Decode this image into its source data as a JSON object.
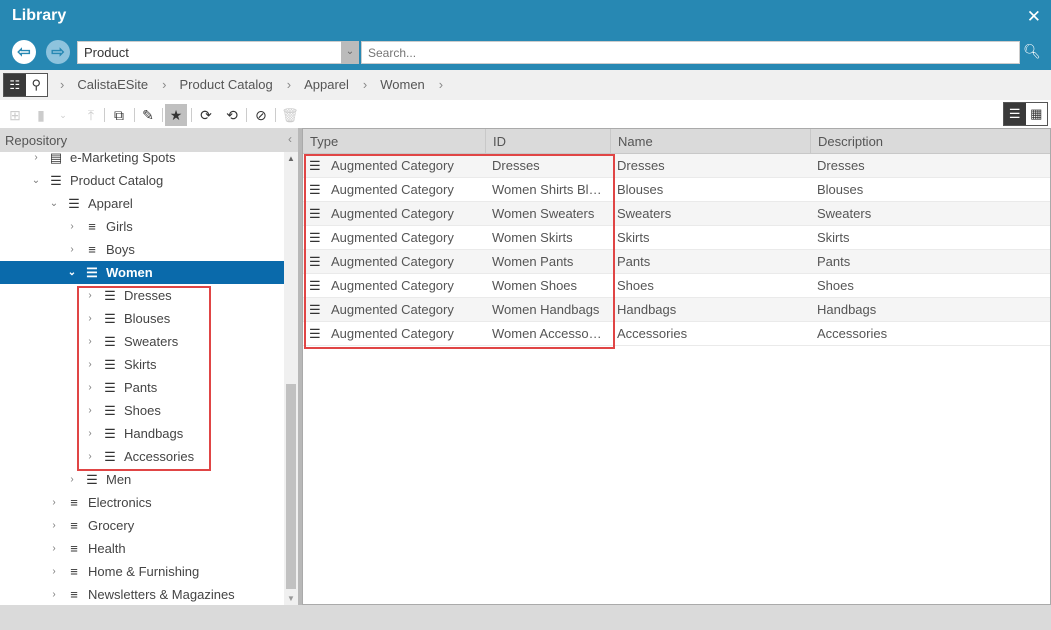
{
  "window": {
    "title": "Library",
    "close_icon": "close-icon"
  },
  "nav": {
    "back_icon": "arrow-left-icon",
    "forward_icon": "arrow-right-icon",
    "type_value": "Product",
    "search_placeholder": "Search...",
    "search_icon": "search-icon"
  },
  "breadcrumb": {
    "items": [
      "CalistaESite",
      "Product Catalog",
      "Apparel",
      "Women"
    ]
  },
  "toolbar": {
    "buttons": [
      "create-folder",
      "create-content",
      "dropdown",
      "move-up",
      "copy",
      "edit",
      "bookmark",
      "sync",
      "sync-check",
      "unsync",
      "delete"
    ]
  },
  "repository": {
    "header": "Repository",
    "nodes": [
      {
        "label": "e-Marketing Spots",
        "depth": 2,
        "expanded": false,
        "icon": "table-icon"
      },
      {
        "label": "Product Catalog",
        "depth": 2,
        "expanded": true,
        "icon": "augmented-category-icon"
      },
      {
        "label": "Apparel",
        "depth": 3,
        "expanded": true,
        "icon": "augmented-category-icon"
      },
      {
        "label": "Girls",
        "depth": 4,
        "expanded": false,
        "icon": "category-icon"
      },
      {
        "label": "Boys",
        "depth": 4,
        "expanded": false,
        "icon": "category-icon"
      },
      {
        "label": "Women",
        "depth": 4,
        "expanded": true,
        "selected": true,
        "icon": "augmented-category-icon"
      },
      {
        "label": "Dresses",
        "depth": 5,
        "expanded": false,
        "icon": "augmented-category-icon"
      },
      {
        "label": "Blouses",
        "depth": 5,
        "expanded": false,
        "icon": "augmented-category-icon"
      },
      {
        "label": "Sweaters",
        "depth": 5,
        "expanded": false,
        "icon": "augmented-category-icon"
      },
      {
        "label": "Skirts",
        "depth": 5,
        "expanded": false,
        "icon": "augmented-category-icon"
      },
      {
        "label": "Pants",
        "depth": 5,
        "expanded": false,
        "icon": "augmented-category-icon"
      },
      {
        "label": "Shoes",
        "depth": 5,
        "expanded": false,
        "icon": "augmented-category-icon"
      },
      {
        "label": "Handbags",
        "depth": 5,
        "expanded": false,
        "icon": "augmented-category-icon"
      },
      {
        "label": "Accessories",
        "depth": 5,
        "expanded": false,
        "icon": "augmented-category-icon"
      },
      {
        "label": "Men",
        "depth": 4,
        "expanded": false,
        "icon": "augmented-category-icon"
      },
      {
        "label": "Electronics",
        "depth": 3,
        "expanded": false,
        "icon": "category-icon"
      },
      {
        "label": "Grocery",
        "depth": 3,
        "expanded": false,
        "icon": "category-icon"
      },
      {
        "label": "Health",
        "depth": 3,
        "expanded": false,
        "icon": "category-icon"
      },
      {
        "label": "Home & Furnishing",
        "depth": 3,
        "expanded": false,
        "icon": "category-icon"
      },
      {
        "label": "Newsletters & Magazines",
        "depth": 3,
        "expanded": false,
        "icon": "category-icon"
      }
    ]
  },
  "table": {
    "columns": [
      "Type",
      "ID",
      "Name",
      "Description"
    ],
    "rows": [
      {
        "type": "Augmented Category",
        "id": "Dresses",
        "name": "Dresses",
        "description": "Dresses"
      },
      {
        "type": "Augmented Category",
        "id": "Women Shirts Blo...",
        "name": "Blouses",
        "description": "Blouses"
      },
      {
        "type": "Augmented Category",
        "id": "Women Sweaters",
        "name": "Sweaters",
        "description": "Sweaters"
      },
      {
        "type": "Augmented Category",
        "id": "Women Skirts",
        "name": "Skirts",
        "description": "Skirts"
      },
      {
        "type": "Augmented Category",
        "id": "Women Pants",
        "name": "Pants",
        "description": "Pants"
      },
      {
        "type": "Augmented Category",
        "id": "Women Shoes",
        "name": "Shoes",
        "description": "Shoes"
      },
      {
        "type": "Augmented Category",
        "id": "Women Handbags",
        "name": "Handbags",
        "description": "Handbags"
      },
      {
        "type": "Augmented Category",
        "id": "Women Accessori...",
        "name": "Accessories",
        "description": "Accessories"
      }
    ]
  },
  "colors": {
    "accent": "#2788b3",
    "selected": "#0a6aab",
    "highlight": "#e04545"
  }
}
